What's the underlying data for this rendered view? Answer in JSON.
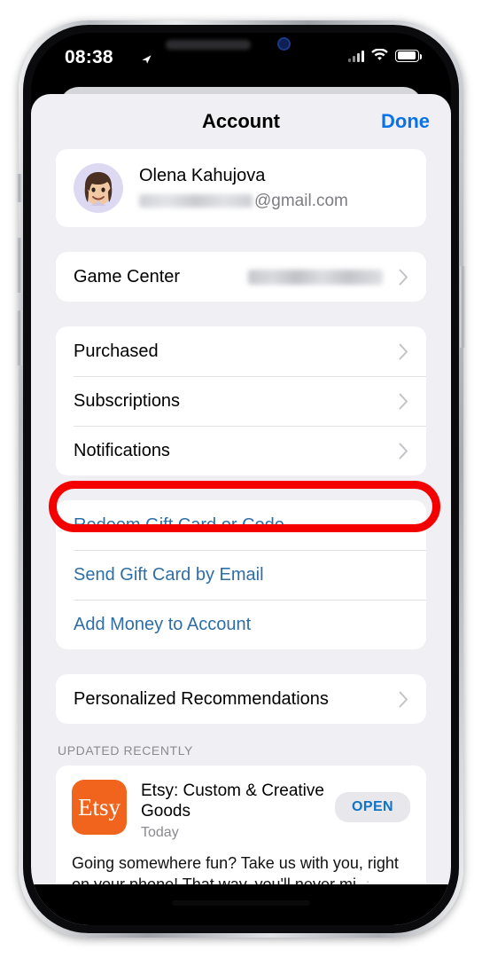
{
  "status_bar": {
    "time": "08:38",
    "location_icon": "location-arrow-icon",
    "cellular_icon": "cellular-signal-icon",
    "wifi_icon": "wifi-icon",
    "battery_icon": "battery-icon"
  },
  "nav": {
    "title": "Account",
    "done_label": "Done"
  },
  "profile": {
    "name": "Olena Kahujova",
    "email_domain": "@gmail.com",
    "email_redacted": true,
    "avatar_icon": "memoji-avatar"
  },
  "sections": {
    "game_center": [
      {
        "label": "Game Center",
        "value_redacted": true,
        "chevron": true
      }
    ],
    "library": [
      {
        "label": "Purchased",
        "chevron": true,
        "highlighted": false
      },
      {
        "label": "Subscriptions",
        "chevron": true,
        "highlighted": true
      },
      {
        "label": "Notifications",
        "chevron": true,
        "highlighted": false
      }
    ],
    "gift_actions": [
      {
        "label": "Redeem Gift Card or Code",
        "style": "link"
      },
      {
        "label": "Send Gift Card by Email",
        "style": "link"
      },
      {
        "label": "Add Money to Account",
        "style": "link"
      }
    ],
    "recommendations": [
      {
        "label": "Personalized Recommendations",
        "chevron": true
      }
    ]
  },
  "updated_recently": {
    "header": "UPDATED RECENTLY",
    "app": {
      "icon_text": "Etsy",
      "icon_color": "#F1641E",
      "name": "Etsy: Custom & Creative Goods",
      "date": "Today",
      "open_label": "OPEN",
      "description": "Going somewhere fun? Take us with you, right on your phone! That way, you'll never miss a new",
      "description_truncated_char": "i",
      "more_label": "more"
    }
  },
  "annotation": {
    "type": "red-oval-highlight",
    "target": "Subscriptions",
    "color": "#f40000"
  },
  "colors": {
    "accent_blue": "#0a72e8",
    "link_blue": "#2f6ea5",
    "open_blue": "#1073c6",
    "sheet_bg": "#f0f0f4",
    "card_bg": "#ffffff",
    "annotation_red": "#f40000"
  },
  "home_indicator": "home-indicator-bar"
}
